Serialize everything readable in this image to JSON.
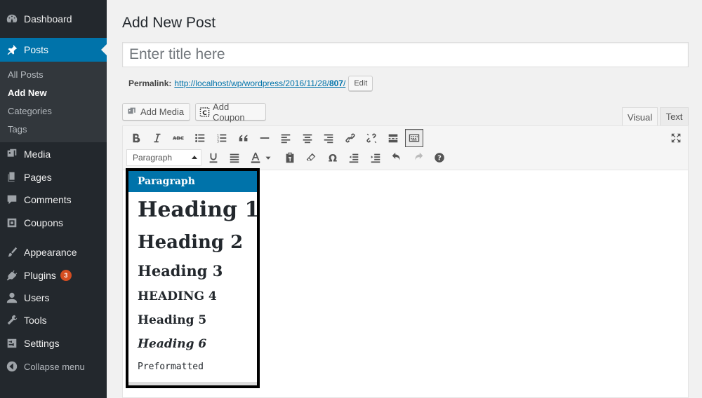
{
  "sidebar": {
    "dashboard": "Dashboard",
    "posts": "Posts",
    "submenu": {
      "all_posts": "All Posts",
      "add_new": "Add New",
      "categories": "Categories",
      "tags": "Tags"
    },
    "media": "Media",
    "pages": "Pages",
    "comments": "Comments",
    "coupons": "Coupons",
    "appearance": "Appearance",
    "plugins": "Plugins",
    "plugins_badge": "3",
    "users": "Users",
    "tools": "Tools",
    "settings": "Settings",
    "collapse": "Collapse menu"
  },
  "main": {
    "page_title": "Add New Post",
    "title_placeholder": "Enter title here",
    "permalink_label": "Permalink:",
    "permalink_base": "http://localhost/wp/wordpress/2016/11/28/",
    "permalink_slug": "807",
    "permalink_trailing": "/",
    "edit_button": "Edit",
    "add_media": "Add Media",
    "add_coupon": "Add Coupon",
    "tab_visual": "Visual",
    "tab_text": "Text"
  },
  "editor": {
    "format_selected": "Paragraph",
    "format_options": [
      "Paragraph",
      "Heading 1",
      "Heading 2",
      "Heading 3",
      "Heading 4",
      "Heading 5",
      "Heading 6",
      "Preformatted"
    ]
  },
  "colors": {
    "sidebar_bg": "#23282d",
    "accent": "#0073aa",
    "badge": "#d54e21"
  }
}
